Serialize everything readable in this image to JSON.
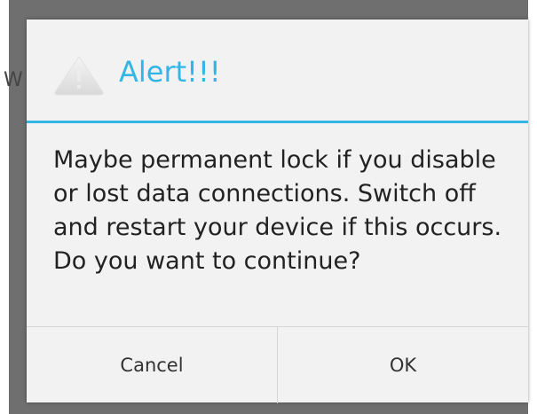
{
  "background": {
    "partial_text": "W"
  },
  "dialog": {
    "title": "Alert!!!",
    "icon": "warning-triangle-icon",
    "message": "Maybe permanent lock if you disable or lost data connections. Switch off and restart your device if this occurs. Do you want to continue?",
    "buttons": {
      "cancel_label": "Cancel",
      "ok_label": "OK"
    },
    "colors": {
      "accent": "#33b5e5",
      "dialog_bg": "#f2f2f2",
      "backdrop": "#6f6f6f"
    }
  }
}
